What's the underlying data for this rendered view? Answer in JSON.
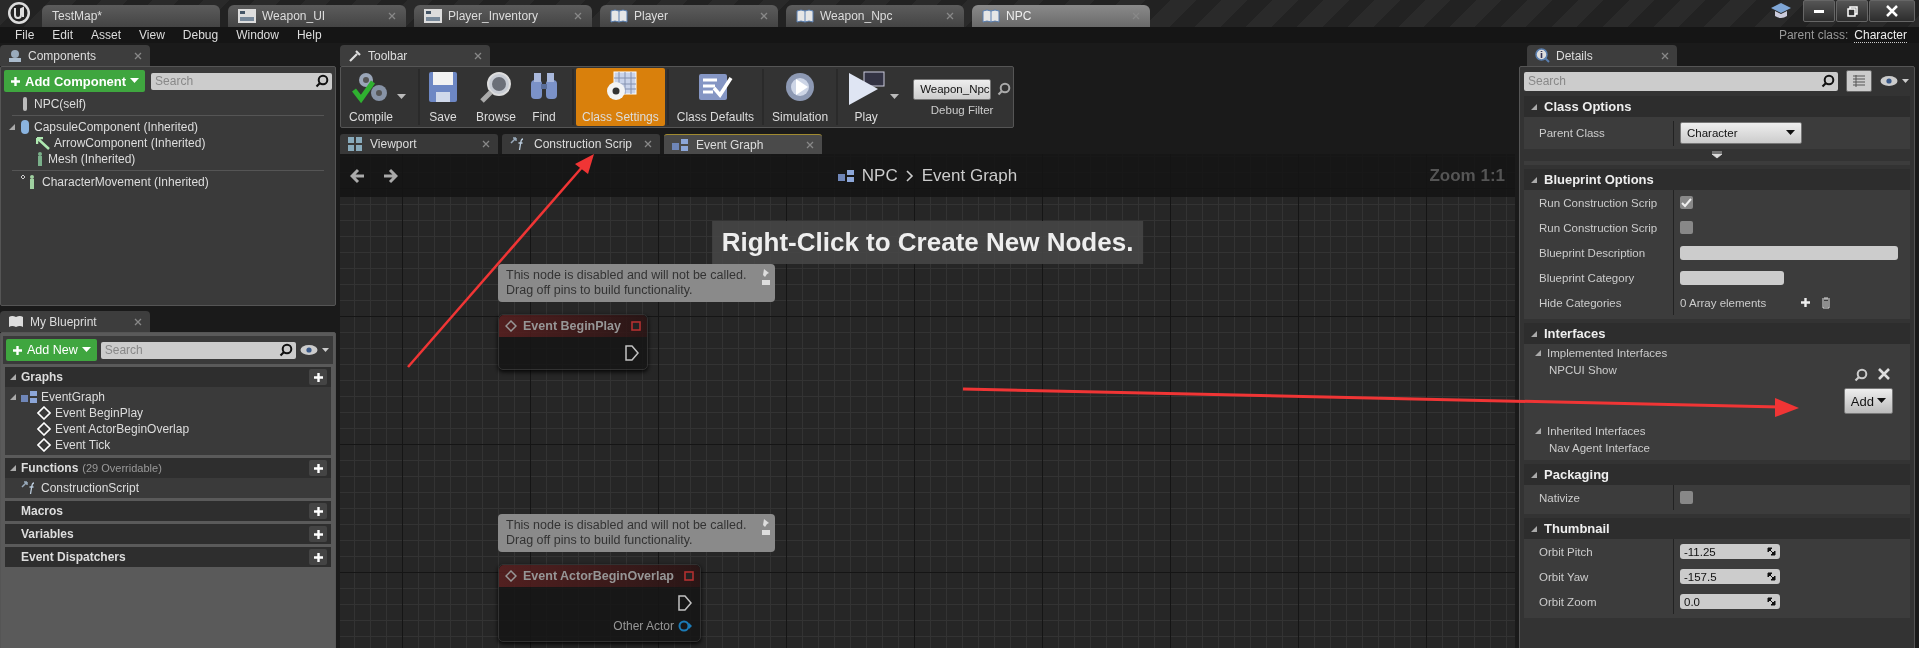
{
  "doc_tabs": [
    {
      "label": "TestMap*",
      "kind": "level",
      "selected": false,
      "closable": false
    },
    {
      "label": "Weapon_UI",
      "kind": "widget",
      "selected": false,
      "closable": true
    },
    {
      "label": "Player_Inventory",
      "kind": "widget",
      "selected": false,
      "closable": true
    },
    {
      "label": "Player",
      "kind": "blueprint",
      "selected": false,
      "closable": true
    },
    {
      "label": "Weapon_Npc",
      "kind": "blueprint",
      "selected": false,
      "closable": true
    },
    {
      "label": "NPC",
      "kind": "blueprint",
      "selected": true,
      "closable": true
    }
  ],
  "menu": [
    "File",
    "Edit",
    "Asset",
    "View",
    "Debug",
    "Window",
    "Help"
  ],
  "parent_class": {
    "label": "Parent class:",
    "value": "Character"
  },
  "components": {
    "tab": "Components",
    "add_button": "Add Component",
    "search": {
      "placeholder": "Search"
    },
    "tree": [
      {
        "label": "NPC(self)",
        "kind": "actor"
      },
      {
        "label": "CapsuleComponent (Inherited)",
        "kind": "capsule",
        "expanded": true,
        "children": [
          {
            "label": "ArrowComponent (Inherited)",
            "kind": "arrow"
          },
          {
            "label": "Mesh (Inherited)",
            "kind": "mesh"
          }
        ]
      },
      {
        "label": "CharacterMovement (Inherited)",
        "kind": "movement"
      }
    ]
  },
  "my_blueprint": {
    "tab": "My Blueprint",
    "add_button": "Add New",
    "search": {
      "placeholder": "Search"
    },
    "sections": [
      {
        "title": "Graphs",
        "expanded": true,
        "items": [
          {
            "label": "EventGraph",
            "kind": "graph",
            "expanded": true,
            "children": [
              {
                "label": "Event BeginPlay",
                "kind": "event"
              },
              {
                "label": "Event ActorBeginOverlap",
                "kind": "event"
              },
              {
                "label": "Event Tick",
                "kind": "event"
              }
            ]
          }
        ]
      },
      {
        "title": "Functions",
        "note": "(29 Overridable)",
        "expanded": true,
        "items": [
          {
            "label": "ConstructionScript",
            "kind": "function"
          }
        ]
      },
      {
        "title": "Macros"
      },
      {
        "title": "Variables"
      },
      {
        "title": "Event Dispatchers"
      }
    ]
  },
  "toolbar": {
    "tab": "Toolbar",
    "buttons": [
      {
        "label": "Compile",
        "kind": "compile",
        "dropdown": true,
        "selected": false
      },
      {
        "label": "Save",
        "kind": "save",
        "dropdown": false,
        "selected": false
      },
      {
        "label": "Browse",
        "kind": "browse",
        "dropdown": false,
        "selected": false
      },
      {
        "label": "Find",
        "kind": "find",
        "dropdown": false,
        "selected": false
      },
      {
        "label": "Class Settings",
        "kind": "settings",
        "dropdown": false,
        "selected": true
      },
      {
        "label": "Class Defaults",
        "kind": "defaults",
        "dropdown": false,
        "selected": false
      },
      {
        "label": "Simulation",
        "kind": "simulation",
        "dropdown": false,
        "selected": false
      },
      {
        "label": "Play",
        "kind": "play",
        "dropdown": true,
        "selected": false
      }
    ],
    "debug_filter": {
      "value": "Weapon_Npc",
      "label": "Debug Filter"
    }
  },
  "graph_tabs": [
    {
      "label": "Viewport",
      "kind": "viewport",
      "selected": false
    },
    {
      "label": "Construction Scrip",
      "kind": "function",
      "selected": false
    },
    {
      "label": "Event Graph",
      "kind": "graph",
      "selected": true
    }
  ],
  "graph": {
    "breadcrumb": [
      "NPC",
      "Event Graph"
    ],
    "zoom": "Zoom 1:1",
    "hint": "Right-Click to Create New Nodes.",
    "nodes": [
      {
        "title": "Event BeginPlay",
        "disabled": true,
        "comment": [
          "This node is disabled and will not be called.",
          "Drag off pins to build functionality."
        ]
      },
      {
        "title": "Event ActorBeginOverlap",
        "disabled": true,
        "comment": [
          "This node is disabled and will not be called.",
          "Drag off pins to build functionality."
        ],
        "outputs": [
          "Other Actor"
        ]
      }
    ]
  },
  "details": {
    "tab": "Details",
    "search": {
      "placeholder": "Search"
    },
    "sections": [
      {
        "title": "Class Options",
        "expanded": true,
        "advanced": true,
        "rows": [
          {
            "label": "Parent Class",
            "kind": "dropdown",
            "value": "Character"
          }
        ]
      },
      {
        "title": "Blueprint Options",
        "expanded": true,
        "rows": [
          {
            "label": "Run Construction Scrip",
            "kind": "checkbox",
            "checked": true
          },
          {
            "label": "Run Construction Scrip",
            "kind": "checkbox",
            "checked": false
          },
          {
            "label": "Blueprint Description",
            "kind": "wide-text"
          },
          {
            "label": "Blueprint Category",
            "kind": "text"
          },
          {
            "label": "Hide Categories",
            "kind": "array",
            "value": "0 Array elements"
          }
        ]
      },
      {
        "title": "Interfaces",
        "expanded": true,
        "groups": [
          {
            "title": "Implemented Interfaces",
            "expanded": true,
            "items": [
              "NPCUI Show"
            ],
            "add_button": "Add"
          },
          {
            "title": "Inherited Interfaces",
            "expanded": true,
            "items": [
              "Nav Agent Interface"
            ]
          }
        ]
      },
      {
        "title": "Packaging",
        "expanded": true,
        "rows": [
          {
            "label": "Nativize",
            "kind": "checkbox",
            "checked": false
          }
        ]
      },
      {
        "title": "Thumbnail",
        "expanded": true,
        "rows": [
          {
            "label": "Orbit Pitch",
            "kind": "number",
            "value": "-11.25"
          },
          {
            "label": "Orbit Yaw",
            "kind": "number",
            "value": "-157.5"
          },
          {
            "label": "Orbit Zoom",
            "kind": "number",
            "value": "0.0"
          }
        ]
      }
    ]
  }
}
